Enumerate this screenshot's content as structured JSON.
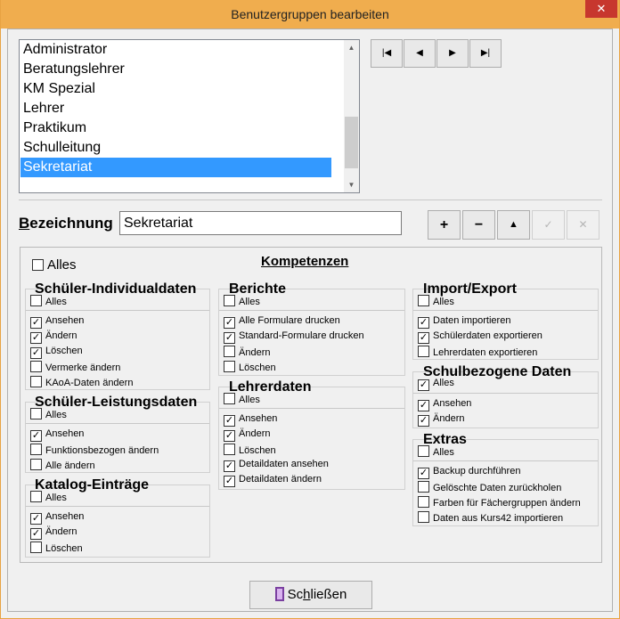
{
  "window": {
    "title": "Benutzergruppen bearbeiten",
    "close_glyph": "✕"
  },
  "list": {
    "items": [
      "Administrator",
      "Beratungslehrer",
      "KM Spezial",
      "Lehrer",
      "Praktikum",
      "Schulleitung",
      "Sekretariat"
    ],
    "selected": "Sekretariat"
  },
  "nav": {
    "first": "|◀",
    "prev": "◀",
    "next": "▶",
    "last": "▶|"
  },
  "bezeichnung": {
    "label_first": "B",
    "label_rest": "ezeichnung",
    "value": "Sekretariat"
  },
  "actions": {
    "add": "+",
    "remove": "−",
    "up": "▲",
    "edit": "✓",
    "cancel": "✕"
  },
  "kompetenzen": {
    "title": "Kompetenzen",
    "alles": "Alles",
    "groups": {
      "schueler_individual": {
        "title": "Schüler-Individualdaten",
        "alles": "Alles",
        "items": [
          "Ansehen",
          "Ändern",
          "Löschen",
          "Vermerke ändern",
          "KAoA-Daten ändern"
        ]
      },
      "schueler_leistung": {
        "title": "Schüler-Leistungsdaten",
        "alles": "Alles",
        "items": [
          "Ansehen",
          "Funktionsbezogen ändern",
          "Alle ändern"
        ]
      },
      "katalog": {
        "title": "Katalog-Einträge",
        "alles": "Alles",
        "items": [
          "Ansehen",
          "Ändern",
          "Löschen"
        ]
      },
      "berichte": {
        "title": "Berichte",
        "alles": "Alles",
        "items": [
          "Alle Formulare drucken",
          "Standard-Formulare drucken",
          "Ändern",
          "Löschen"
        ]
      },
      "lehrerdaten": {
        "title": "Lehrerdaten",
        "alles": "Alles",
        "items": [
          "Ansehen",
          "Ändern",
          "Löschen",
          "Detaildaten ansehen",
          "Detaildaten ändern"
        ]
      },
      "import_export": {
        "title": "Import/Export",
        "alles": "Alles",
        "items": [
          "Daten importieren",
          "Schülerdaten exportieren",
          "Lehrerdaten exportieren"
        ]
      },
      "schulbezogen": {
        "title": "Schulbezogene Daten",
        "alles": "Alles",
        "items": [
          "Ansehen",
          "Ändern"
        ]
      },
      "extras": {
        "title": "Extras",
        "alles": "Alles",
        "items": [
          "Backup durchführen",
          "Gelöschte Daten zurückholen",
          "Farben für Fächergruppen ändern",
          "Daten aus Kurs42 importieren"
        ]
      }
    }
  },
  "close_button": {
    "label_pre": "Sc",
    "label_ul": "h",
    "label_post": "ließen"
  },
  "check_glyph": "✓"
}
